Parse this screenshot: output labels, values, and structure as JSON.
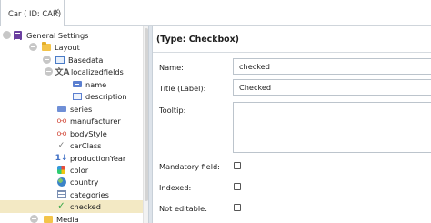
{
  "tab": {
    "label": "Car ( ID: CAR)",
    "close_glyph": "×"
  },
  "tree": {
    "items": [
      {
        "label": "General Settings",
        "icon": "class-icon"
      },
      {
        "label": "Layout",
        "icon": "folder-icon"
      },
      {
        "label": "Basedata",
        "icon": "panel-icon"
      },
      {
        "label": "localizedfields",
        "icon": "language-icon"
      },
      {
        "label": "name",
        "icon": "input-icon"
      },
      {
        "label": "description",
        "icon": "textarea-icon"
      },
      {
        "label": "series",
        "icon": "series-icon"
      },
      {
        "label": "manufacturer",
        "icon": "relation-icon"
      },
      {
        "label": "bodyStyle",
        "icon": "relation-icon"
      },
      {
        "label": "carClass",
        "icon": "select-icon"
      },
      {
        "label": "productionYear",
        "icon": "number-icon"
      },
      {
        "label": "color",
        "icon": "color-icon"
      },
      {
        "label": "country",
        "icon": "globe-icon"
      },
      {
        "label": "categories",
        "icon": "multiselect-icon"
      },
      {
        "label": "checked",
        "icon": "checkbox-icon",
        "selected": true
      },
      {
        "label": "Media",
        "icon": "folder-icon"
      }
    ]
  },
  "editor": {
    "title": "(Type: Checkbox)",
    "name_label": "Name:",
    "name_value": "checked",
    "title_label": "Title (Label):",
    "title_value": "Checked",
    "tooltip_label": "Tooltip:",
    "tooltip_value": "",
    "mandatory_label": "Mandatory field:",
    "mandatory_checked": false,
    "indexed_label": "Indexed:",
    "indexed_checked": false,
    "not_editable_label": "Not editable:",
    "not_editable_checked": false
  },
  "colors": {
    "selection": "#f3e9c4",
    "splitter": "#dde3ea"
  }
}
